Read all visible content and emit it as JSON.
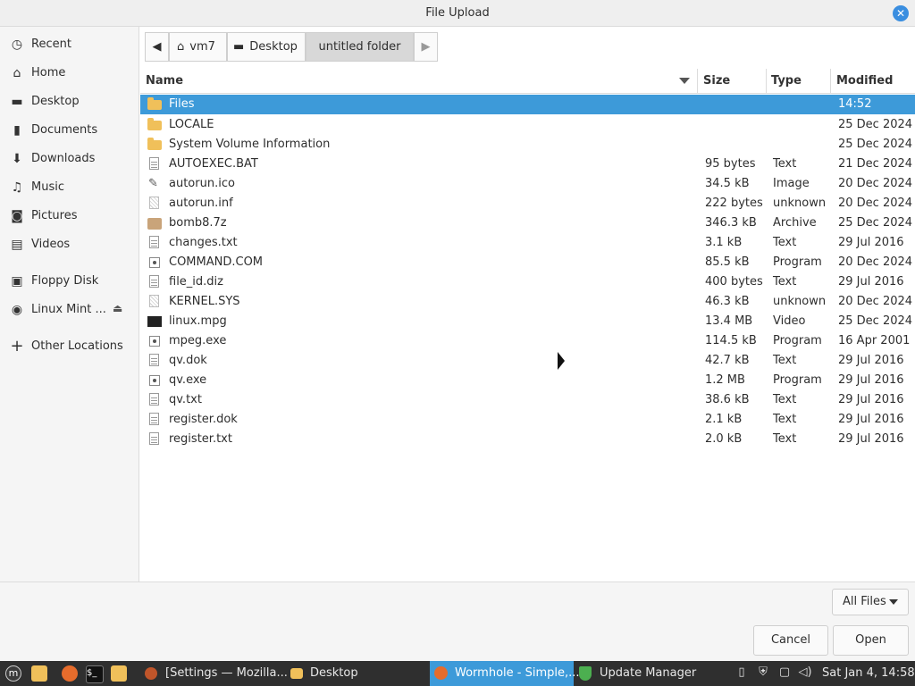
{
  "window": {
    "title": "File Upload"
  },
  "sidebar": {
    "items": [
      {
        "label": "Recent",
        "icon": "clock-icon"
      },
      {
        "label": "Home",
        "icon": "home-icon"
      },
      {
        "label": "Desktop",
        "icon": "desktop-icon"
      },
      {
        "label": "Documents",
        "icon": "document-icon"
      },
      {
        "label": "Downloads",
        "icon": "download-icon"
      },
      {
        "label": "Music",
        "icon": "music-icon"
      },
      {
        "label": "Pictures",
        "icon": "camera-icon"
      },
      {
        "label": "Videos",
        "icon": "film-icon"
      },
      {
        "label": "Floppy Disk",
        "icon": "floppy-icon"
      },
      {
        "label": "Linux Mint ...",
        "icon": "disc-icon"
      },
      {
        "label": "Other Locations",
        "icon": "plus-icon"
      }
    ]
  },
  "pathbar": {
    "crumbs": [
      "vm7",
      "Desktop",
      "untitled folder"
    ]
  },
  "columns": {
    "name": "Name",
    "size": "Size",
    "type": "Type",
    "modified": "Modified"
  },
  "files": [
    {
      "name": "Files",
      "size": "",
      "type": "",
      "modified": "14:52",
      "kind": "folder"
    },
    {
      "name": "LOCALE",
      "size": "",
      "type": "",
      "modified": "25 Dec 2024",
      "kind": "folder"
    },
    {
      "name": "System Volume Information",
      "size": "",
      "type": "",
      "modified": "25 Dec 2024",
      "kind": "folder"
    },
    {
      "name": "AUTOEXEC.BAT",
      "size": "95 bytes",
      "type": "Text",
      "modified": "21 Dec 2024",
      "kind": "text"
    },
    {
      "name": "autorun.ico",
      "size": "34.5 kB",
      "type": "Image",
      "modified": "20 Dec 2024",
      "kind": "image"
    },
    {
      "name": "autorun.inf",
      "size": "222 bytes",
      "type": "unknown",
      "modified": "20 Dec 2024",
      "kind": "unknown"
    },
    {
      "name": "bomb8.7z",
      "size": "346.3 kB",
      "type": "Archive",
      "modified": "25 Dec 2024",
      "kind": "archive"
    },
    {
      "name": "changes.txt",
      "size": "3.1 kB",
      "type": "Text",
      "modified": "29 Jul 2016",
      "kind": "text"
    },
    {
      "name": "COMMAND.COM",
      "size": "85.5 kB",
      "type": "Program",
      "modified": "20 Dec 2024",
      "kind": "program"
    },
    {
      "name": "file_id.diz",
      "size": "400 bytes",
      "type": "Text",
      "modified": "29 Jul 2016",
      "kind": "text"
    },
    {
      "name": "KERNEL.SYS",
      "size": "46.3 kB",
      "type": "unknown",
      "modified": "20 Dec 2024",
      "kind": "unknown"
    },
    {
      "name": "linux.mpg",
      "size": "13.4 MB",
      "type": "Video",
      "modified": "25 Dec 2024",
      "kind": "video"
    },
    {
      "name": "mpeg.exe",
      "size": "114.5 kB",
      "type": "Program",
      "modified": "16 Apr 2001",
      "kind": "program"
    },
    {
      "name": "qv.dok",
      "size": "42.7 kB",
      "type": "Text",
      "modified": "29 Jul 2016",
      "kind": "text"
    },
    {
      "name": "qv.exe",
      "size": "1.2 MB",
      "type": "Program",
      "modified": "29 Jul 2016",
      "kind": "program"
    },
    {
      "name": "qv.txt",
      "size": "38.6 kB",
      "type": "Text",
      "modified": "29 Jul 2016",
      "kind": "text"
    },
    {
      "name": "register.dok",
      "size": "2.1 kB",
      "type": "Text",
      "modified": "29 Jul 2016",
      "kind": "text"
    },
    {
      "name": "register.txt",
      "size": "2.0 kB",
      "type": "Text",
      "modified": "29 Jul 2016",
      "kind": "text"
    }
  ],
  "filter": {
    "label": "All Files"
  },
  "buttons": {
    "cancel": "Cancel",
    "open": "Open"
  },
  "taskbar": {
    "tasks": [
      "[Settings — Mozilla...",
      "Desktop",
      "Wormhole - Simple,...",
      "Update Manager"
    ],
    "clock": "Sat Jan  4, 14:58"
  },
  "colors": {
    "selection": "#3d9ad9",
    "accent": "#3a8ee0",
    "folder": "#f0c05a",
    "taskbar": "#2f2f2f"
  }
}
